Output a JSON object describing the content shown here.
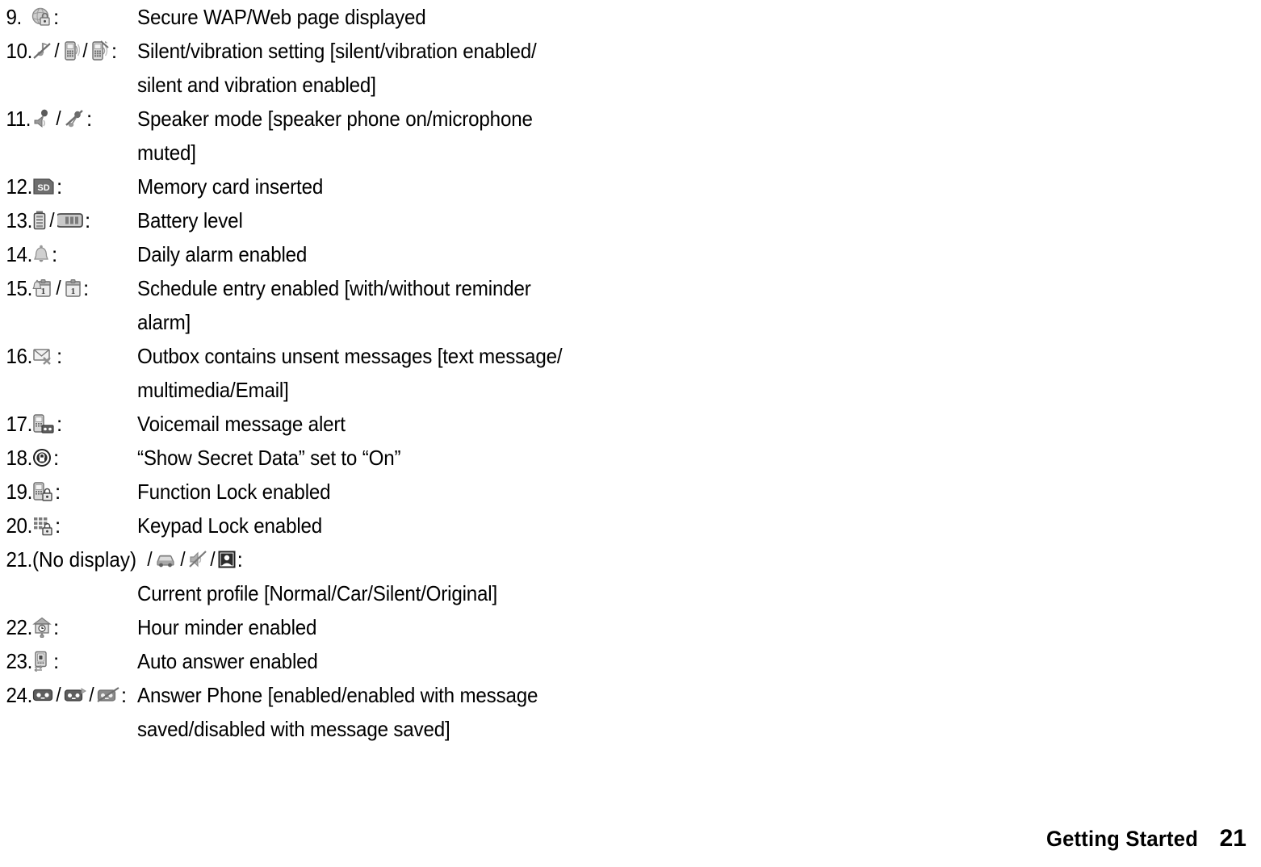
{
  "page": {
    "footer_title": "Getting Started",
    "footer_page": "21"
  },
  "list": {
    "separator": "/",
    "colon": ":",
    "entries": [
      {
        "number": "9.",
        "icons": [
          "secure-web-page-icon"
        ],
        "description_lines": [
          "Secure WAP/Web page displayed"
        ],
        "desc_on_own_line": false
      },
      {
        "number": "10.",
        "icons": [
          "silent-note-icon",
          "vibration-phone-icon",
          "silent-vibration-phone-icon"
        ],
        "description_lines": [
          "Silent/vibration setting [silent/vibration enabled/",
          "silent and vibration enabled]"
        ],
        "desc_on_own_line": false
      },
      {
        "number": "11.",
        "icons": [
          "speaker-phone-icon",
          "microphone-muted-icon"
        ],
        "description_lines": [
          "Speaker mode [speaker phone on/microphone",
          "muted]"
        ],
        "desc_on_own_line": false
      },
      {
        "number": "12.",
        "icons": [
          "memory-card-icon"
        ],
        "description_lines": [
          "Memory card inserted"
        ],
        "desc_on_own_line": false
      },
      {
        "number": "13.",
        "icons": [
          "battery-vertical-icon",
          "battery-horizontal-icon"
        ],
        "description_lines": [
          "Battery level"
        ],
        "desc_on_own_line": false
      },
      {
        "number": "14.",
        "icons": [
          "alarm-bell-icon"
        ],
        "description_lines": [
          "Daily alarm enabled"
        ],
        "desc_on_own_line": false
      },
      {
        "number": "15.",
        "icons": [
          "schedule-with-alarm-icon",
          "schedule-icon"
        ],
        "description_lines": [
          "Schedule entry enabled [with/without reminder",
          "alarm]"
        ],
        "desc_on_own_line": false
      },
      {
        "number": "16.",
        "icons": [
          "unsent-message-icon"
        ],
        "description_lines": [
          "Outbox contains unsent messages [text message/",
          "multimedia/Email]"
        ],
        "desc_on_own_line": false
      },
      {
        "number": "17.",
        "icons": [
          "voicemail-alert-icon"
        ],
        "description_lines": [
          "Voicemail message alert"
        ],
        "desc_on_own_line": false
      },
      {
        "number": "18.",
        "icons": [
          "secret-data-icon"
        ],
        "description_lines": [
          "“Show Secret Data” set to “On”"
        ],
        "desc_on_own_line": false
      },
      {
        "number": "19.",
        "icons": [
          "function-lock-icon"
        ],
        "description_lines": [
          "Function Lock enabled"
        ],
        "desc_on_own_line": false
      },
      {
        "number": "20.",
        "icons": [
          "keypad-lock-icon"
        ],
        "description_lines": [
          "Keypad Lock enabled"
        ],
        "desc_on_own_line": false
      },
      {
        "number": "21.",
        "lead_text": "(No display)",
        "icons": [
          "car-profile-icon",
          "silent-profile-icon",
          "original-profile-icon"
        ],
        "description_lines": [
          "Current profile [Normal/Car/Silent/Original]"
        ],
        "desc_on_own_line": true
      },
      {
        "number": "22.",
        "icons": [
          "hour-minder-clock-icon"
        ],
        "description_lines": [
          "Hour minder enabled"
        ],
        "desc_on_own_line": false
      },
      {
        "number": "23.",
        "icons": [
          "auto-answer-icon"
        ],
        "description_lines": [
          "Auto answer enabled"
        ],
        "desc_on_own_line": false
      },
      {
        "number": "24.",
        "icons": [
          "answer-phone-icon",
          "answer-phone-saved-icon",
          "answer-phone-disabled-icon"
        ],
        "description_lines": [
          "Answer Phone [enabled/enabled with message",
          "saved/disabled with message saved]"
        ],
        "desc_on_own_line": false
      }
    ]
  }
}
